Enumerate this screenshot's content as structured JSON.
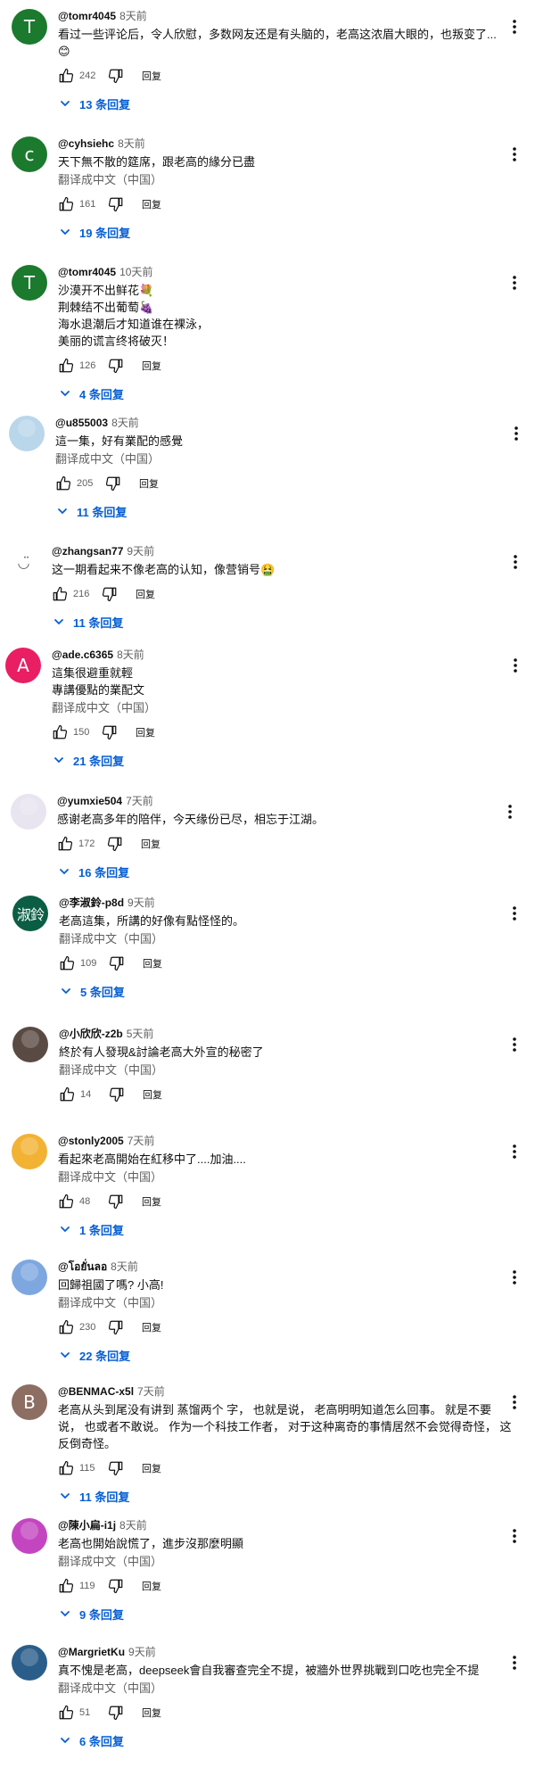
{
  "ui": {
    "reply_label": "回复",
    "translate_label": "翻译成中文（中国）",
    "link_color": "#065fd4"
  },
  "comments": [
    {
      "author": "@tomr4045",
      "time": "8天前",
      "avatar_letter": "T",
      "avatar_color": "#1b7a2d",
      "lines": [
        "看过一些评论后，令人欣慰，多数网友还是有头脑的，老高这浓眉大眼的，也叛变了...",
        "😊"
      ],
      "translated": false,
      "likes": "242",
      "replies": "13 条回复"
    },
    {
      "author": "@cyhsiehc",
      "time": "8天前",
      "avatar_letter": "c",
      "avatar_color": "#1b7a2d",
      "lines": [
        "天下無不散的筵席，跟老高的緣分已盡"
      ],
      "translated": true,
      "likes": "161",
      "replies": "19 条回复"
    },
    {
      "author": "@tomr4045",
      "time": "10天前",
      "avatar_letter": "T",
      "avatar_color": "#1b7a2d",
      "lines": [
        "沙漠开不出鲜花💐",
        "荆棘结不出葡萄🍇",
        "海水退潮后才知道谁在裸泳，",
        "美丽的谎言终将破灭！"
      ],
      "translated": false,
      "likes": "126",
      "replies": "4 条回复"
    },
    {
      "author": "@u855003",
      "time": "8天前",
      "avatar_letter": "",
      "avatar_color": "#b9d6ea",
      "lines": [
        "這一集，好有業配的感覺"
      ],
      "translated": true,
      "likes": "205",
      "replies": "11 条回复"
    },
    {
      "author": "@zhangsan77",
      "time": "9天前",
      "avatar_letter": "◡̈",
      "avatar_color": "#ffffff",
      "lines": [
        "这一期看起来不像老高的认知，像营销号🤮"
      ],
      "translated": false,
      "likes": "216",
      "replies": "11 条回复"
    },
    {
      "author": "@ade.c6365",
      "time": "8天前",
      "avatar_letter": "A",
      "avatar_color": "#e91e63",
      "lines": [
        "這集很避重就輕",
        "專講優點的業配文"
      ],
      "translated": true,
      "likes": "150",
      "replies": "21 条回复"
    },
    {
      "author": "@yumxie504",
      "time": "7天前",
      "avatar_letter": "",
      "avatar_color": "#e8e4f0",
      "lines": [
        "感谢老高多年的陪伴，今天缘份已尽，相忘于江湖。"
      ],
      "translated": false,
      "likes": "172",
      "replies": "16 条回复"
    },
    {
      "author": "@李淑鈴-p8d",
      "time": "9天前",
      "avatar_letter": "淑鈴",
      "avatar_color": "#0b5d44",
      "lines": [
        "老高這集，所講的好像有點怪怪的。"
      ],
      "translated": true,
      "likes": "109",
      "replies": "5 条回复"
    },
    {
      "author": "@小欣欣-z2b",
      "time": "5天前",
      "avatar_letter": "",
      "avatar_color": "#5a4a44",
      "lines": [
        "終於有人發現&討論老高大外宣的秘密了"
      ],
      "translated": true,
      "likes": "14",
      "replies": ""
    },
    {
      "author": "@stonly2005",
      "time": "7天前",
      "avatar_letter": "",
      "avatar_color": "#f2b233",
      "lines": [
        "看起來老高開始在紅移中了....加油...."
      ],
      "translated": true,
      "likes": "48",
      "replies": "1 条回复"
    },
    {
      "author": "@โอยั่นลอ",
      "time": "8天前",
      "avatar_letter": "",
      "avatar_color": "#7ea7e0",
      "lines": [
        "回歸祖國了嗎? 小高!"
      ],
      "translated": true,
      "likes": "230",
      "replies": "22 条回复"
    },
    {
      "author": "@BENMAC-x5l",
      "time": "7天前",
      "avatar_letter": "B",
      "avatar_color": "#8d6e63",
      "lines": [
        "老高从头到尾没有讲到 蒸馏两个 字， 也就是说， 老高明明知道怎么回事。 就是不要",
        "说， 也或者不敢说。 作为一个科技工作者， 对于这种离奇的事情居然不会觉得奇怪， 这",
        "反倒奇怪。"
      ],
      "translated": false,
      "likes": "115",
      "replies": "11 条回复"
    },
    {
      "author": "@陳小扁-i1j",
      "time": "8天前",
      "avatar_letter": "",
      "avatar_color": "#c346c0",
      "lines": [
        "老高也開始說慌了，進步沒那麼明顯"
      ],
      "translated": true,
      "likes": "119",
      "replies": "9 条回复"
    },
    {
      "author": "@MargrietKu",
      "time": "9天前",
      "avatar_letter": "",
      "avatar_color": "#2a5d8a",
      "lines": [
        "真不愧是老高，deepseek會自我審查完全不提，被牆外世界挑戰到口吃也完全不提"
      ],
      "translated": true,
      "likes": "51",
      "replies": "6 条回复"
    }
  ]
}
